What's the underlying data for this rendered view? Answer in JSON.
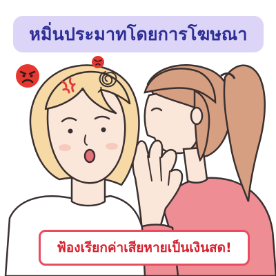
{
  "header": {
    "title": "หมิ่นประมาทโดยการโฆษณา"
  },
  "caption": {
    "text": "ฟ้องเรียกค่าเสียหายเป็นเงินสด!"
  },
  "icons": [
    "angry-face-icon",
    "angry-face-icon",
    "anger-mark-icon",
    "frustration-scribble-icon"
  ],
  "colors": {
    "title_background": "#dcd5f7",
    "title_text": "#2d2d96",
    "caption_border": "#e94b5f",
    "caption_text": "#d7222f",
    "angry_face": "#e5362f",
    "skin": "#fbe6da",
    "hair_left": "#f7d9a6",
    "hair_right": "#d79f82",
    "shirt_right": "#ee8d94"
  }
}
